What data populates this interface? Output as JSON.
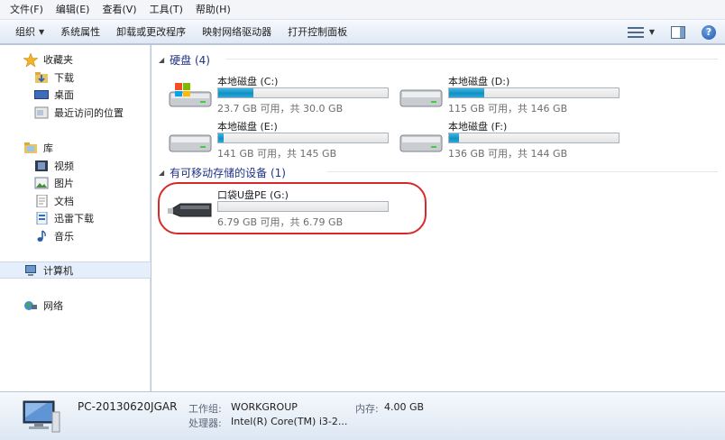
{
  "menu": [
    "文件(F)",
    "编辑(E)",
    "查看(V)",
    "工具(T)",
    "帮助(H)"
  ],
  "toolbar": {
    "organize": "组织",
    "system_properties": "系统属性",
    "uninstall": "卸载或更改程序",
    "map_drive": "映射网络驱动器",
    "control_panel": "打开控制面板",
    "help_glyph": "?"
  },
  "nav": {
    "favorites": "收藏夹",
    "downloads": "下载",
    "desktop": "桌面",
    "recent": "最近访问的位置",
    "libraries": "库",
    "videos": "视频",
    "pictures": "图片",
    "documents": "文档",
    "xunlei": "迅雷下载",
    "music": "音乐",
    "computer": "计算机",
    "network": "网络"
  },
  "groups": {
    "hard_disks": "硬盘 (4)",
    "removable": "有可移动存储的设备 (1)"
  },
  "drives": [
    {
      "name": "本地磁盘 (C:)",
      "size": "23.7 GB 可用，共 30.0 GB",
      "used_fraction": 0.21
    },
    {
      "name": "本地磁盘 (D:)",
      "size": "115 GB 可用，共 146 GB",
      "used_fraction": 0.21
    },
    {
      "name": "本地磁盘 (E:)",
      "size": "141 GB 可用，共 145 GB",
      "used_fraction": 0.03
    },
    {
      "name": "本地磁盘 (F:)",
      "size": "136 GB 可用，共 144 GB",
      "used_fraction": 0.06
    },
    {
      "name": "口袋U盘PE (G:)",
      "size": "6.79 GB 可用，共 6.79 GB",
      "used_fraction": 0.0
    }
  ],
  "details": {
    "pc_name": "PC-20130620JGAR",
    "workgroup_label": "工作组:",
    "workgroup": "WORKGROUP",
    "memory_label": "内存:",
    "memory": "4.00 GB",
    "cpu_label": "处理器:",
    "cpu": "Intel(R) Core(TM) i3-2..."
  },
  "colors": {
    "bar_fill": "#1a9ad0",
    "highlight": "#d62a2a",
    "group_header": "#1e3287"
  }
}
